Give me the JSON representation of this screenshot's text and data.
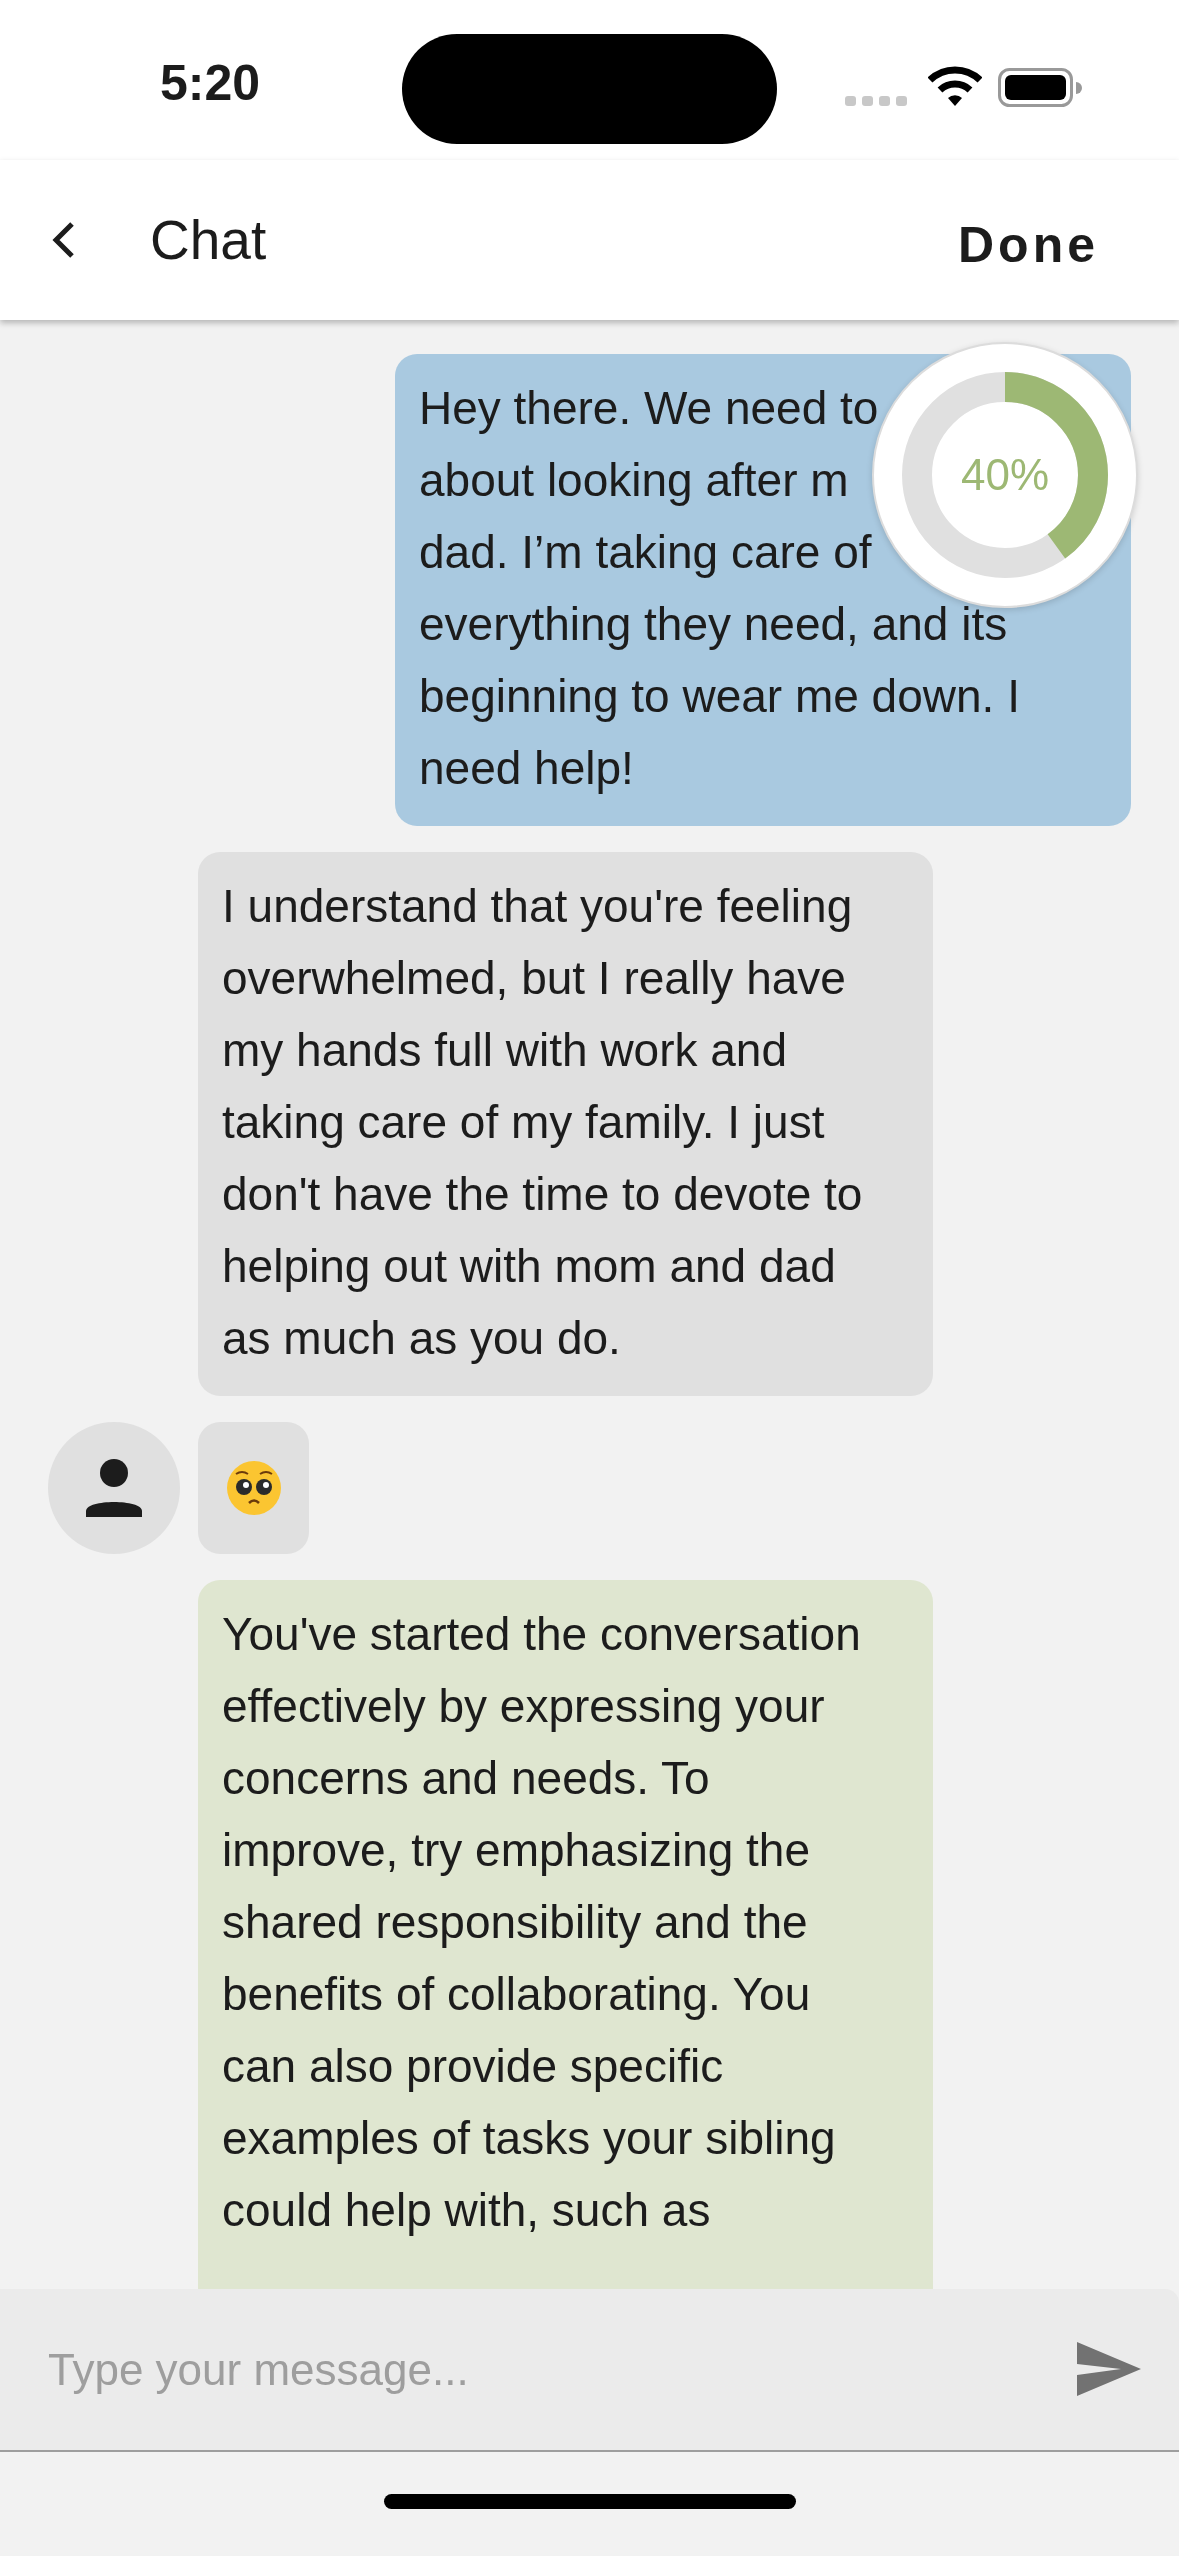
{
  "status_bar": {
    "time": "5:20"
  },
  "header": {
    "title": "Chat",
    "done": "Done"
  },
  "progress": {
    "level": 0.4,
    "label": "40%"
  },
  "messages": [
    {
      "kind": "user",
      "lines": [
        "Hey there. We need to",
        "about looking after m",
        "dad. I’m taking care of",
        "everything they need, and its",
        "beginning to wear me down. I",
        "need help!"
      ],
      "avatar": false
    },
    {
      "kind": "partner",
      "text": "I understand that you're feeling overwhelmed, but I really have my hands full with work and taking care of my family. I just don't have the time to devote to helping out with mom and dad as much as you do.",
      "avatar": false
    },
    {
      "kind": "emoji",
      "avatar": true
    },
    {
      "kind": "feedback",
      "text": "You've started the conversation effectively by expressing your concerns and needs. To improve, try emphasizing the shared responsibility and the benefits of collaborating. You can also provide specific examples of tasks your sibling could help with, such as",
      "avatar": false
    }
  ],
  "composer": {
    "placeholder": "Type your message..."
  }
}
